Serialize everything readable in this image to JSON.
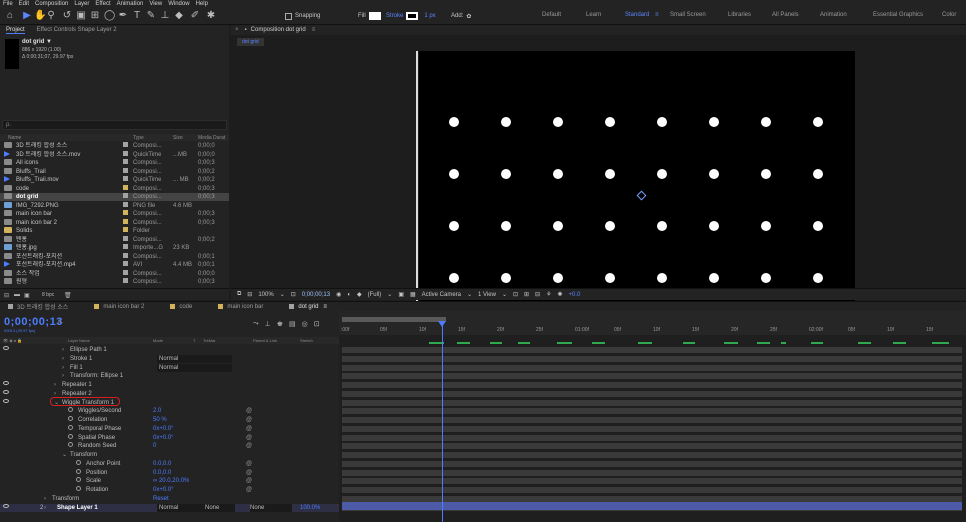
{
  "menu": [
    "File",
    "Edit",
    "Composition",
    "Layer",
    "Effect",
    "Animation",
    "View",
    "Window",
    "Help"
  ],
  "toolbar": {
    "snapping": "Snapping",
    "fill": "Fill",
    "stroke": "Stroke",
    "stroke_px": "1 px",
    "add": "Add:",
    "workspaces": [
      "Default",
      "Learn",
      "Standard",
      "Small Screen",
      "Libraries",
      "All Panels",
      "Animation",
      "Essential Graphics",
      "Color"
    ],
    "active_workspace": "Standard"
  },
  "project": {
    "tab_project": "Project",
    "tab_effects": "Effect Controls Shape Layer 2",
    "selected_name": "dot grid ▼",
    "selected_dims": "886 x 1920 (1.00)",
    "selected_dur": "Δ 0;00;31;07, 29.97 fps",
    "search_placeholder": "ρ.",
    "headers": {
      "name": "Name",
      "type": "Type",
      "size": "Size",
      "dur": "Media Durat"
    },
    "items": [
      {
        "name": "3D 트래킹 합성 소스",
        "type": "Composi...",
        "size": "",
        "dur": "0;00;0",
        "icon": "comp",
        "color": "#a3a3a3"
      },
      {
        "name": "3D 트래킹 합성 소스.mov",
        "type": "QuickTime",
        "size": "...MB",
        "dur": "0;00;0",
        "icon": "mov",
        "color": "#a3a3a3"
      },
      {
        "name": "All icons",
        "type": "Composi...",
        "size": "",
        "dur": "0;00;3",
        "icon": "comp",
        "color": "#a3a3a3"
      },
      {
        "name": "Bluffs_Trail",
        "type": "Composi...",
        "size": "",
        "dur": "0;00;2",
        "icon": "comp",
        "color": "#a3a3a3"
      },
      {
        "name": "Bluffs_Trail.mov",
        "type": "QuickTime",
        "size": "... MB",
        "dur": "0;00;2",
        "icon": "mov",
        "color": "#a3a3a3"
      },
      {
        "name": "code",
        "type": "Composi...",
        "size": "",
        "dur": "0;00;3",
        "icon": "comp",
        "color": "#d2b35b"
      },
      {
        "name": "dot grid",
        "type": "Composi...",
        "size": "",
        "dur": "0;00;3",
        "icon": "comp",
        "color": "#a3a3a3"
      },
      {
        "name": "IMG_7292.PNG",
        "type": "PNG file",
        "size": "4.6 MB",
        "dur": "",
        "icon": "png",
        "color": "#a3a3a3"
      },
      {
        "name": "main icon bar",
        "type": "Composi...",
        "size": "",
        "dur": "0;00;3",
        "icon": "comp",
        "color": "#d2b35b"
      },
      {
        "name": "main icon bar 2",
        "type": "Composi...",
        "size": "",
        "dur": "0;00;3",
        "icon": "comp",
        "color": "#d2b35b"
      },
      {
        "name": "Solids",
        "type": "Folder",
        "size": "",
        "dur": "",
        "icon": "fold",
        "color": "#d2b35b"
      },
      {
        "name": "텐홍",
        "type": "Composi...",
        "size": "",
        "dur": "0;00;2",
        "icon": "comp",
        "color": "#a3a3a3"
      },
      {
        "name": "텐홍.jpg",
        "type": "Importe...G",
        "size": "23 KB",
        "dur": "",
        "icon": "png",
        "color": "#a3a3a3"
      },
      {
        "name": "포선트래킹-포지션",
        "type": "Composi...",
        "size": "",
        "dur": "0;00;1",
        "icon": "comp",
        "color": "#a3a3a3"
      },
      {
        "name": "포선트래킹-포지션.mp4",
        "type": "AVI",
        "size": "4.4 MB",
        "dur": "0;00;1",
        "icon": "mov",
        "color": "#a3a3a3"
      },
      {
        "name": "소스 작업",
        "type": "Composi...",
        "size": "",
        "dur": "0;00;0",
        "icon": "comp",
        "color": "#a3a3a3"
      },
      {
        "name": "원형",
        "type": "Composi...",
        "size": "",
        "dur": "0;00;3",
        "icon": "comp",
        "color": "#a3a3a3"
      }
    ],
    "selected_index": 6,
    "footer_bpc": "8 bpc"
  },
  "comp": {
    "tab_label": "Composition dot grid",
    "sub_tab": "dot grid",
    "zoom": "100%",
    "timecode": "0;00;00;13",
    "resolution": "(Full)",
    "camera": "Active Camera",
    "view": "1 View",
    "exposure": "+0.0"
  },
  "timeline": {
    "tabs": [
      {
        "label": "3D 트래킹 합성 소스",
        "color": "#a3a3a3"
      },
      {
        "label": "main icon bar 2",
        "color": "#d2b35b"
      },
      {
        "label": "code",
        "color": "#d2b35b"
      },
      {
        "label": "main icon bar",
        "color": "#d2b35b"
      },
      {
        "label": "dot grid",
        "color": "#a3a3a3"
      }
    ],
    "active_tab": 4,
    "timecode": "0;00;00;13",
    "timecode_sub": "00013 (29.97 fps)",
    "search_placeholder": "ρ.",
    "col_headers": {
      "name": "Layer Name",
      "mode": "Mode",
      "t": "T",
      "trkmat": "TrkMat",
      "parent": "Parent & Link",
      "stretch": "Stretch"
    },
    "ruler": [
      ":00f",
      "05f",
      "10f",
      "15f",
      "20f",
      "25f",
      "01:00f",
      "05f",
      "10f",
      "15f",
      "20f",
      "25f",
      "02:00f",
      "05f",
      "10f",
      "15f"
    ],
    "rows": [
      {
        "name": "Ellipse Path 1",
        "indent": 70,
        "value": "",
        "mode": ""
      },
      {
        "name": "Stroke 1",
        "indent": 70,
        "value": "",
        "mode": "Normal"
      },
      {
        "name": "Fill 1",
        "indent": 70,
        "value": "",
        "mode": "Normal"
      },
      {
        "name": "Transform: Ellipse 1",
        "indent": 70,
        "value": "",
        "mode": ""
      },
      {
        "name": "Repeater 1",
        "indent": 62,
        "value": "",
        "mode": ""
      },
      {
        "name": "Repeater 2",
        "indent": 62,
        "value": "",
        "mode": ""
      },
      {
        "name": "Wiggle Transform 1",
        "indent": 62,
        "value": "",
        "mode": ""
      },
      {
        "name": "Wiggles/Second",
        "indent": 78,
        "value": "2.0",
        "mode": ""
      },
      {
        "name": "Correlation",
        "indent": 78,
        "value": "50 %",
        "mode": ""
      },
      {
        "name": "Temporal Phase",
        "indent": 78,
        "value": "0x+0.0°",
        "mode": ""
      },
      {
        "name": "Spatial Phase",
        "indent": 78,
        "value": "0x+0.0°",
        "mode": ""
      },
      {
        "name": "Random Seed",
        "indent": 78,
        "value": "0",
        "mode": ""
      },
      {
        "name": "Transform",
        "indent": 70,
        "value": "",
        "mode": ""
      },
      {
        "name": "Anchor Point",
        "indent": 86,
        "value": "0.0,0.0",
        "mode": ""
      },
      {
        "name": "Position",
        "indent": 86,
        "value": "0.0,0.0",
        "mode": ""
      },
      {
        "name": "Scale",
        "indent": 86,
        "value": "∞ 20.0,20.0%",
        "mode": ""
      },
      {
        "name": "Rotation",
        "indent": 86,
        "value": "0x+0.0°",
        "mode": ""
      },
      {
        "name": "Transform",
        "indent": 52,
        "value": "Reset",
        "mode": ""
      },
      {
        "name": "Shape Layer 1",
        "indent": 52,
        "value": "",
        "mode": "Normal"
      }
    ],
    "layer_num": "2",
    "layer_trkmat": "None",
    "layer_parent": "None",
    "layer_stretch": "100.0%"
  }
}
